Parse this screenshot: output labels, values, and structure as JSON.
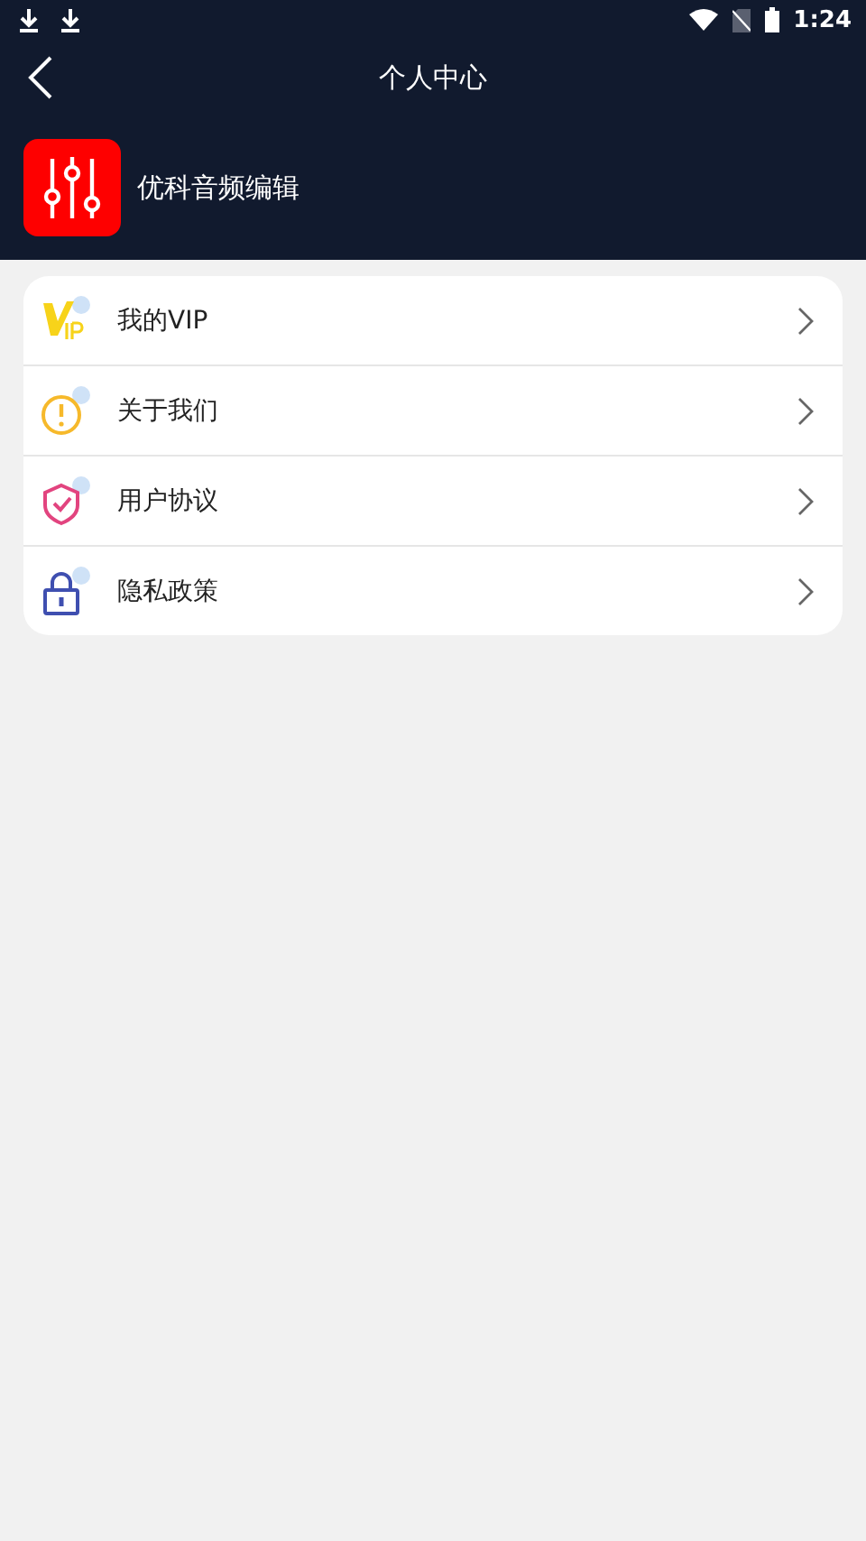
{
  "status_bar": {
    "time": "1:24"
  },
  "header": {
    "title": "个人中心",
    "app_name": "优科音频编辑"
  },
  "menu": [
    {
      "kind": "vip",
      "label": "我的VIP"
    },
    {
      "kind": "about",
      "label": "关于我们"
    },
    {
      "kind": "agreement",
      "label": "用户协议"
    },
    {
      "kind": "privacy",
      "label": "隐私政策"
    }
  ]
}
